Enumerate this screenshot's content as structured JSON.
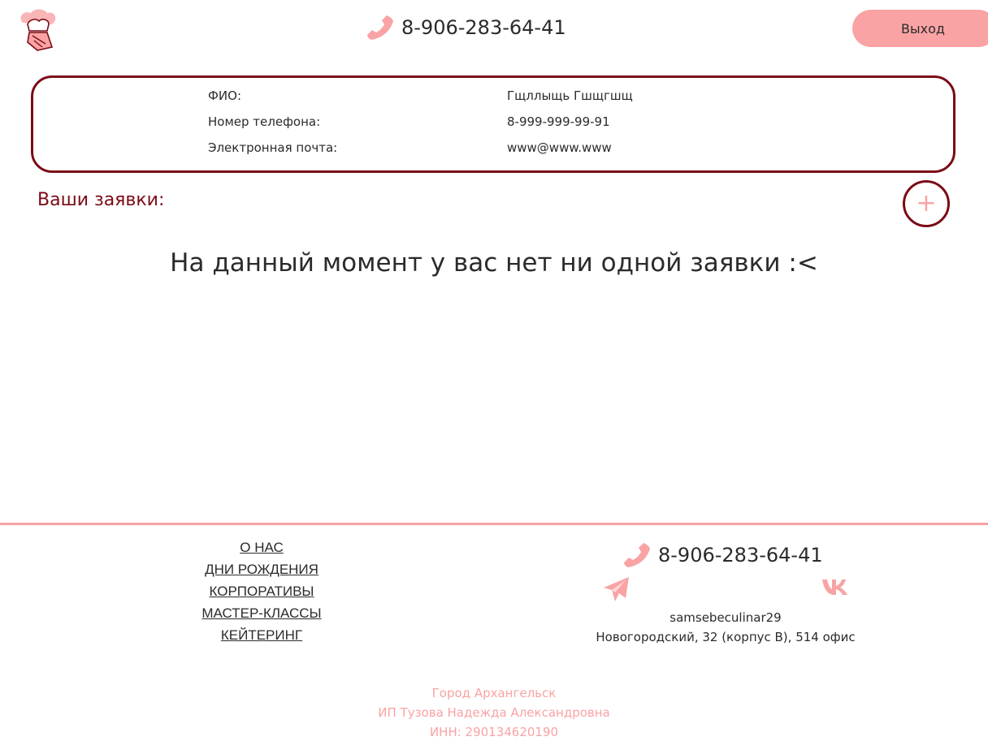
{
  "header": {
    "logo_icon": "chef-logo-icon",
    "phone": "8-906-283-64-41",
    "logout_label": "Выход"
  },
  "profile": {
    "rows": [
      {
        "label": "ФИО:",
        "value": "Гщллыщь Гшщгшщ"
      },
      {
        "label": "Номер телефона:",
        "value": "8-999-999-99-91"
      },
      {
        "label": "Электронная почта:",
        "value": "www@www.www"
      }
    ]
  },
  "orders": {
    "title": "Ваши заявки:",
    "add_label": "+",
    "empty_message": "На данный момент у вас нет ни одной заявки :<"
  },
  "footer": {
    "nav": [
      "О НАС",
      "ДНИ РОЖДЕНИЯ",
      "КОРПОРАТИВЫ",
      "МАСТЕР-КЛАССЫ",
      "КЕЙТЕРИНГ"
    ],
    "phone": "8-906-283-64-41",
    "social_handle": "samsebeculinar29",
    "address": "Новогородский, 32 (корпус В), 514 офис",
    "city": "Город Архангельск",
    "entrepreneur": "ИП Тузова Надежда Александровна",
    "inn": "ИНН: 290134620190"
  },
  "colors": {
    "accent_pink": "#f9a3a4",
    "accent_maroon": "#7b0b16",
    "text": "#2b2b2b"
  }
}
